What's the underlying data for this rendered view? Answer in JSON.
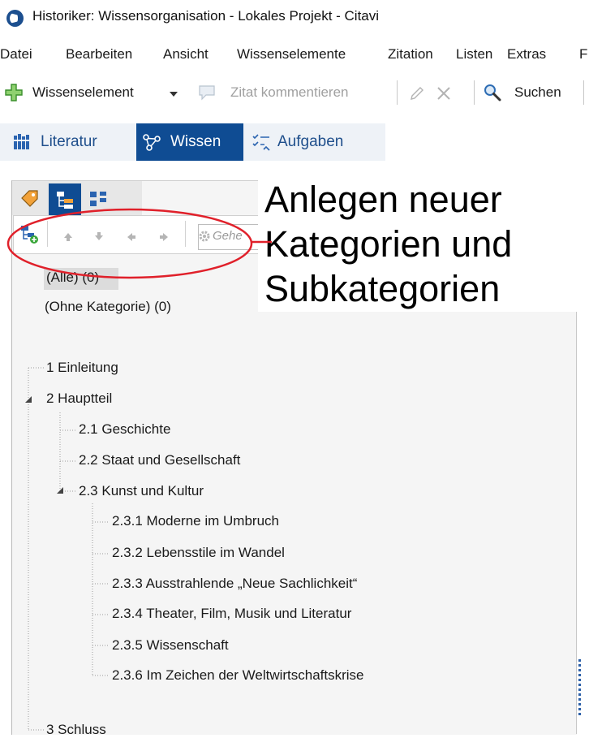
{
  "window": {
    "title": "Historiker: Wissensorganisation - Lokales Projekt - Citavi"
  },
  "menu": [
    "Datei",
    "Bearbeiten",
    "Ansicht",
    "Wissenselemente",
    "Zitation",
    "Listen",
    "Extras",
    "F"
  ],
  "toolbar": {
    "new_knowledge_label": "Wissenselement",
    "comment_quote_label": "Zitat kommentieren",
    "search_label": "Suchen"
  },
  "nav_tabs": [
    {
      "label": "Literatur",
      "active": false
    },
    {
      "label": "Wissen",
      "active": true
    },
    {
      "label": "Aufgaben",
      "active": false
    }
  ],
  "category_search": {
    "placeholder": "Gehe"
  },
  "callout": {
    "lines": [
      "Anlegen neuer",
      "Kategorien und",
      "Subkategorien"
    ]
  },
  "categories": {
    "all": "(Alle) (0)",
    "without": "(Ohne Kategorie) (0)",
    "items": [
      "1 Einleitung",
      "2 Hauptteil",
      "2.1 Geschichte",
      "2.2 Staat und Gesellschaft",
      "2.3 Kunst und Kultur",
      "2.3.1 Moderne im Umbruch",
      "2.3.2 Lebensstile im Wandel",
      "2.3.3 Ausstrahlende „Neue Sachlichkeit“",
      "2.3.4 Theater, Film, Musik und Literatur",
      "2.3.5 Wissenschaft",
      "2.3.6 Im Zeichen der Weltwirtschaftskrise",
      "3 Schluss"
    ]
  },
  "colors": {
    "accent": "#0f4c93",
    "annotation": "#e0202a",
    "add_icon": "#3aa63a"
  }
}
